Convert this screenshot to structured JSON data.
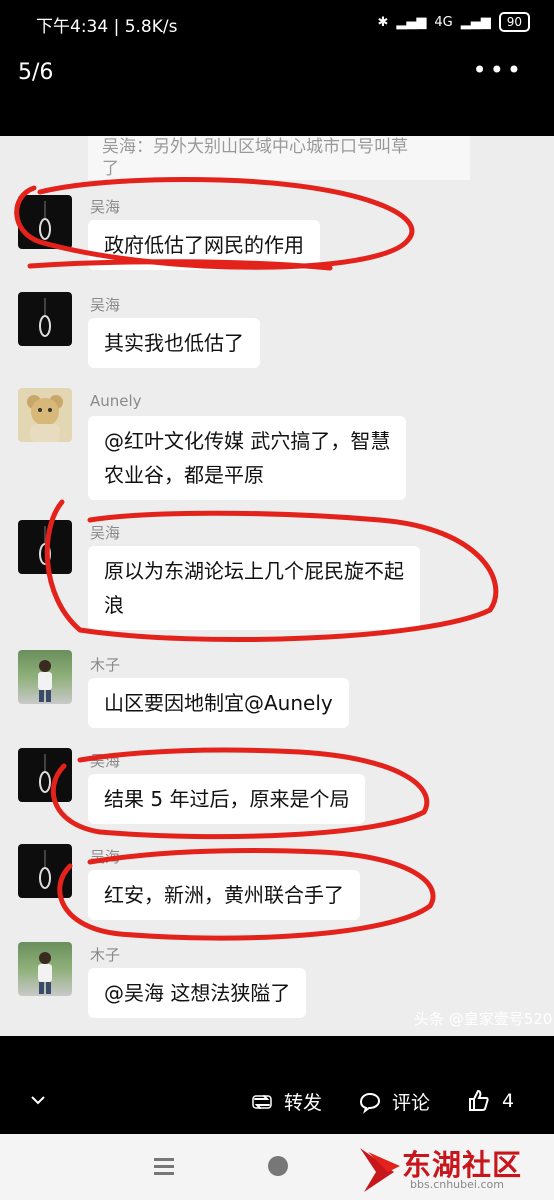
{
  "status": {
    "time": "下午4:34 | 5.8K/s",
    "network": "4G",
    "battery": "90"
  },
  "viewer": {
    "counter": "5/6",
    "more": "•••"
  },
  "chat": {
    "prev_message": {
      "line1": "吴海：另外大别山区域中心城市口号叫草",
      "line2": "了"
    },
    "messages": [
      {
        "sender": "吴海",
        "lines": [
          "政府低估了网民的作用"
        ]
      },
      {
        "sender": "吴海",
        "lines": [
          "其实我也低估了"
        ]
      },
      {
        "sender": "Aunely",
        "lines": [
          "@红叶文化传媒  武穴搞了，智慧",
          "农业谷，都是平原"
        ]
      },
      {
        "sender": "吴海",
        "lines": [
          "原以为东湖论坛上几个屁民旋不起",
          "浪"
        ]
      },
      {
        "sender": "木子",
        "lines": [
          "山区要因地制宜@Aunely"
        ]
      },
      {
        "sender": "吴海",
        "lines": [
          "结果 5 年过后，原来是个局"
        ]
      },
      {
        "sender": "吴海",
        "lines": [
          "红安，新洲，黄州联合手了"
        ]
      },
      {
        "sender": "木子",
        "lines": [
          "@吴海  这想法狭隘了"
        ]
      }
    ]
  },
  "watermark": "头条 @皇家壹号520",
  "actions": {
    "share": "转发",
    "comment": "评论",
    "like_count": "4"
  },
  "logo": {
    "text": "东湖社区",
    "url": "bbs.cnhubei.com"
  },
  "colors": {
    "annotation": "#e3231b"
  }
}
